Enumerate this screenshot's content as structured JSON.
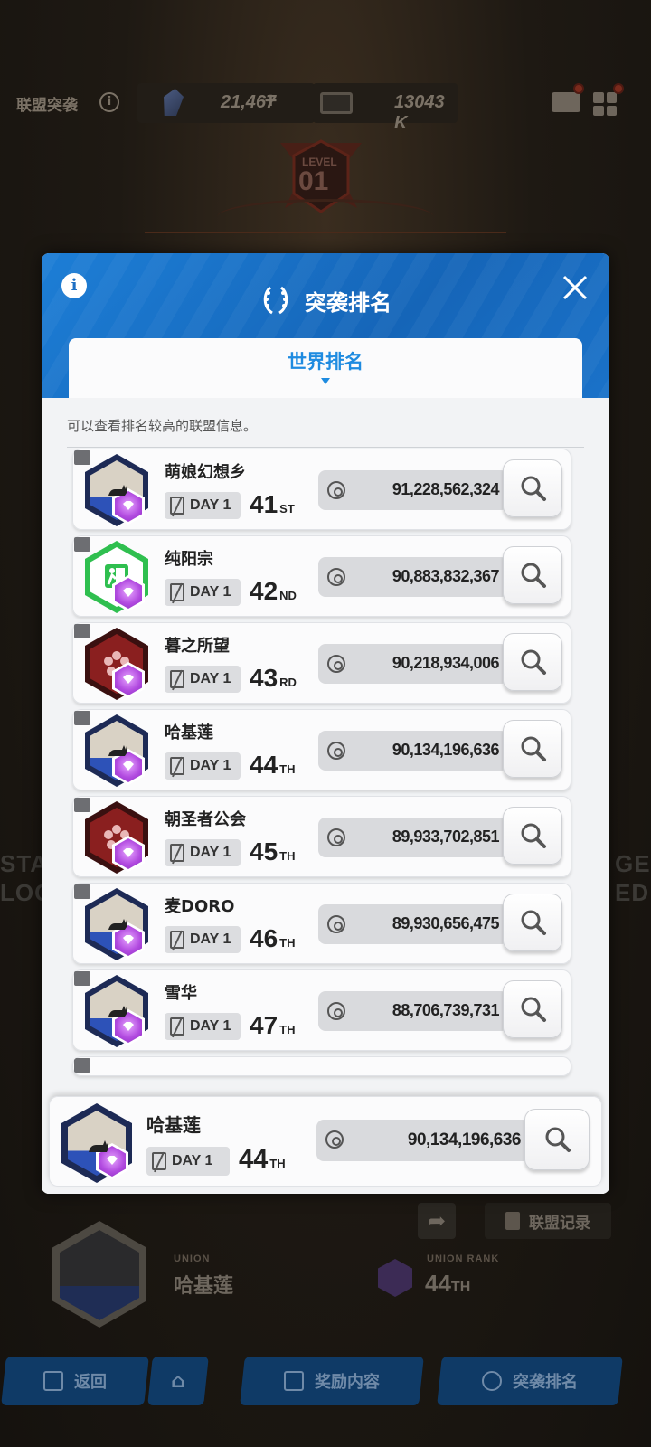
{
  "background": {
    "topbar": {
      "title": "联盟突袭",
      "crystal_value": "21,467",
      "crystal_plus": "+",
      "ticket_value": "13043 K"
    },
    "level_label": "LEVEL",
    "level_value": "01",
    "left_side_text_1": "STA",
    "left_side_text_2": "LOC",
    "right_side_text_1": "GE",
    "right_side_text_2": "ED",
    "union": {
      "label": "UNION",
      "name": "哈基莲",
      "rank_label": "UNION RANK",
      "rank_number": "44",
      "rank_suffix": "TH"
    },
    "record_button": "联盟记录",
    "nav": {
      "back": "返回",
      "reward": "奖励内容",
      "raid_rank": "突袭排名"
    }
  },
  "modal": {
    "title": "突袭排名",
    "tab": "世界排名",
    "hint": "可以查看排名较高的联盟信息。",
    "rows": [
      {
        "name": "萌娘幻想乡",
        "day": "DAY 1",
        "rank": "41",
        "suffix": "ST",
        "score": "91,228,562,324",
        "emblem": "cat"
      },
      {
        "name": "纯阳宗",
        "day": "DAY 1",
        "rank": "42",
        "suffix": "ND",
        "score": "90,883,832,367",
        "emblem": "exit"
      },
      {
        "name": "暮之所望",
        "day": "DAY 1",
        "rank": "43",
        "suffix": "RD",
        "score": "90,218,934,006",
        "emblem": "flower"
      },
      {
        "name": "哈基莲",
        "day": "DAY 1",
        "rank": "44",
        "suffix": "TH",
        "score": "90,134,196,636",
        "emblem": "cat"
      },
      {
        "name": "朝圣者公会",
        "day": "DAY 1",
        "rank": "45",
        "suffix": "TH",
        "score": "89,933,702,851",
        "emblem": "flower"
      },
      {
        "name": "麦DORO",
        "day": "DAY 1",
        "rank": "46",
        "suffix": "TH",
        "score": "89,930,656,475",
        "emblem": "cat"
      },
      {
        "name": "雪华",
        "day": "DAY 1",
        "rank": "47",
        "suffix": "TH",
        "score": "88,706,739,731",
        "emblem": "cat"
      }
    ],
    "own": {
      "name": "哈基莲",
      "day": "DAY 1",
      "rank": "44",
      "suffix": "TH",
      "score": "90,134,196,636"
    }
  },
  "colors": {
    "header_blue": "#1d7ed6",
    "tab_text": "#1e8be0",
    "gem_purple": "#b24be0",
    "exit_green": "#2fbf4f",
    "flower_red": "#8a1f1f"
  }
}
